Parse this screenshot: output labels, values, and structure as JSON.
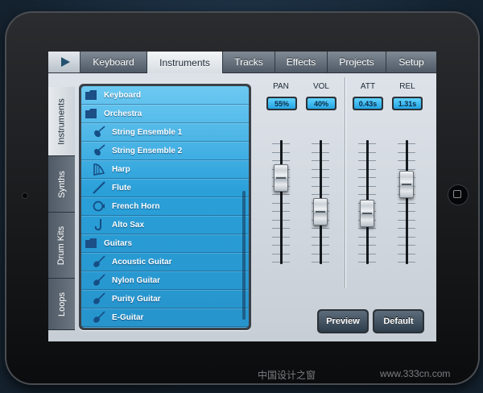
{
  "tabs": [
    {
      "label": "Keyboard",
      "active": false
    },
    {
      "label": "Instruments",
      "active": true
    },
    {
      "label": "Tracks",
      "active": false
    },
    {
      "label": "Effects",
      "active": false
    },
    {
      "label": "Projects",
      "active": false
    },
    {
      "label": "Setup",
      "active": false
    }
  ],
  "side_tabs": [
    {
      "label": "Instruments",
      "active": true
    },
    {
      "label": "Synths",
      "active": false
    },
    {
      "label": "Drum Kits",
      "active": false
    },
    {
      "label": "Loops",
      "active": false
    }
  ],
  "list": [
    {
      "label": "Keyboard",
      "type": "folder",
      "icon": "folder-icon"
    },
    {
      "label": "Orchestra",
      "type": "folder",
      "icon": "folder-icon"
    },
    {
      "label": "String Ensemble 1",
      "type": "item",
      "icon": "violin-icon"
    },
    {
      "label": "String Ensemble 2",
      "type": "item",
      "icon": "violin-icon"
    },
    {
      "label": "Harp",
      "type": "item",
      "icon": "harp-icon"
    },
    {
      "label": "Flute",
      "type": "item",
      "icon": "flute-icon"
    },
    {
      "label": "French Horn",
      "type": "item",
      "icon": "french-horn-icon"
    },
    {
      "label": "Alto Sax",
      "type": "item",
      "icon": "saxophone-icon"
    },
    {
      "label": "Guitars",
      "type": "folder",
      "icon": "folder-icon"
    },
    {
      "label": "Acoustic Guitar",
      "type": "item",
      "icon": "guitar-icon"
    },
    {
      "label": "Nylon Guitar",
      "type": "item",
      "icon": "guitar-icon"
    },
    {
      "label": "Purity Guitar",
      "type": "item",
      "icon": "guitar-icon"
    },
    {
      "label": "E-Guitar",
      "type": "item",
      "icon": "guitar-icon"
    }
  ],
  "mixer": {
    "channels": [
      {
        "label": "PAN",
        "value": "55%",
        "level": 0.75
      },
      {
        "label": "VOL",
        "value": "40%",
        "level": 0.4
      },
      {
        "label": "ATT",
        "value": "0.43s",
        "level": 0.38
      },
      {
        "label": "REL",
        "value": "1.31s",
        "level": 0.68
      }
    ]
  },
  "buttons": {
    "preview": "Preview",
    "default": "Default"
  },
  "watermark": {
    "left": "中国设计之窗",
    "right": "www.333cn.com"
  },
  "colors": {
    "accent": "#2aa4e0",
    "list_top": "#34b4ec"
  }
}
